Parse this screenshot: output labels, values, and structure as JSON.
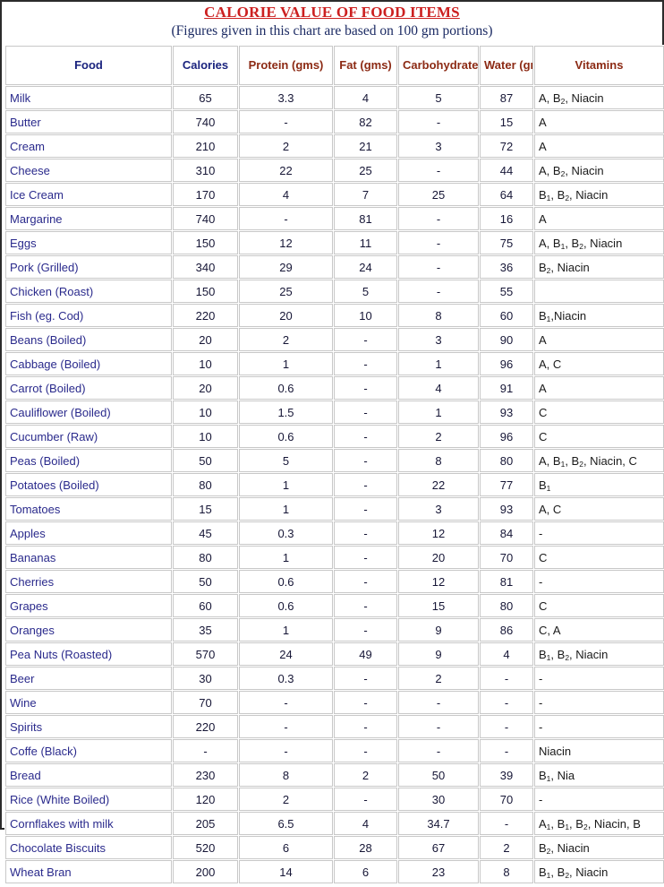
{
  "document": {
    "title": "CALORIE VALUE OF FOOD ITEMS",
    "subtitle": "(Figures given in this chart are based on 100 gm portions)",
    "title_color": "#cc2020",
    "subtitle_color": "#1b2a63"
  },
  "chart_data": {
    "type": "table",
    "title": "CALORIE VALUE OF FOOD ITEMS",
    "subtitle": "(Figures given in this chart are based on 100 gm portions)",
    "columns": [
      {
        "key": "food",
        "label": "Food",
        "color": "#1a237e",
        "align": "left"
      },
      {
        "key": "calories",
        "label": "Calories",
        "color": "#1a237e",
        "align": "center"
      },
      {
        "key": "protein",
        "label": "Protein (gms)",
        "color": "#8c2a14",
        "align": "center"
      },
      {
        "key": "fat",
        "label": "Fat (gms)",
        "color": "#8c2a14",
        "align": "center"
      },
      {
        "key": "carbohydrate",
        "label": "Carbohydrate (gms)",
        "color": "#8c2a14",
        "align": "center"
      },
      {
        "key": "water",
        "label": "Water (gms)",
        "color": "#8c2a14",
        "align": "center"
      },
      {
        "key": "vitamins",
        "label": "Vitamins",
        "color": "#8c2a14",
        "align": "left"
      }
    ],
    "rows": [
      {
        "food": "Milk",
        "calories": "65",
        "protein": "3.3",
        "fat": "4",
        "carbohydrate": "5",
        "water": "87",
        "vitamins": "A, B2, Niacin"
      },
      {
        "food": "Butter",
        "calories": "740",
        "protein": "-",
        "fat": "82",
        "carbohydrate": "-",
        "water": "15",
        "vitamins": "A"
      },
      {
        "food": "Cream",
        "calories": "210",
        "protein": "2",
        "fat": "21",
        "carbohydrate": "3",
        "water": "72",
        "vitamins": "A"
      },
      {
        "food": "Cheese",
        "calories": "310",
        "protein": "22",
        "fat": "25",
        "carbohydrate": "-",
        "water": "44",
        "vitamins": "A, B2, Niacin"
      },
      {
        "food": "Ice Cream",
        "calories": "170",
        "protein": "4",
        "fat": "7",
        "carbohydrate": "25",
        "water": "64",
        "vitamins": "B1, B2, Niacin"
      },
      {
        "food": "Margarine",
        "calories": "740",
        "protein": "-",
        "fat": "81",
        "carbohydrate": "-",
        "water": "16",
        "vitamins": "A"
      },
      {
        "food": "Eggs",
        "calories": "150",
        "protein": "12",
        "fat": "11",
        "carbohydrate": "-",
        "water": "75",
        "vitamins": "A, B1, B2, Niacin"
      },
      {
        "food": "Pork (Grilled)",
        "calories": "340",
        "protein": "29",
        "fat": "24",
        "carbohydrate": "-",
        "water": "36",
        "vitamins": "B2, Niacin"
      },
      {
        "food": "Chicken (Roast)",
        "calories": "150",
        "protein": "25",
        "fat": "5",
        "carbohydrate": "-",
        "water": "55",
        "vitamins": ""
      },
      {
        "food": "Fish (eg. Cod)",
        "calories": "220",
        "protein": "20",
        "fat": "10",
        "carbohydrate": "8",
        "water": "60",
        "vitamins": "B1,Niacin"
      },
      {
        "food": "Beans (Boiled)",
        "calories": "20",
        "protein": "2",
        "fat": "-",
        "carbohydrate": "3",
        "water": "90",
        "vitamins": "A"
      },
      {
        "food": "Cabbage (Boiled)",
        "calories": "10",
        "protein": "1",
        "fat": "-",
        "carbohydrate": "1",
        "water": "96",
        "vitamins": "A, C"
      },
      {
        "food": "Carrot (Boiled)",
        "calories": "20",
        "protein": "0.6",
        "fat": "-",
        "carbohydrate": "4",
        "water": "91",
        "vitamins": "A"
      },
      {
        "food": "Cauliflower (Boiled)",
        "calories": "10",
        "protein": "1.5",
        "fat": "-",
        "carbohydrate": "1",
        "water": "93",
        "vitamins": "C"
      },
      {
        "food": "Cucumber (Raw)",
        "calories": "10",
        "protein": "0.6",
        "fat": "-",
        "carbohydrate": "2",
        "water": "96",
        "vitamins": "C"
      },
      {
        "food": "Peas (Boiled)",
        "calories": "50",
        "protein": "5",
        "fat": "-",
        "carbohydrate": "8",
        "water": "80",
        "vitamins": "A, B1, B2, Niacin, C"
      },
      {
        "food": "Potatoes (Boiled)",
        "calories": "80",
        "protein": "1",
        "fat": "-",
        "carbohydrate": "22",
        "water": "77",
        "vitamins": "B1"
      },
      {
        "food": "Tomatoes",
        "calories": "15",
        "protein": "1",
        "fat": "-",
        "carbohydrate": "3",
        "water": "93",
        "vitamins": "A, C"
      },
      {
        "food": "Apples",
        "calories": "45",
        "protein": "0.3",
        "fat": "-",
        "carbohydrate": "12",
        "water": "84",
        "vitamins": "-"
      },
      {
        "food": "Bananas",
        "calories": "80",
        "protein": "1",
        "fat": "-",
        "carbohydrate": "20",
        "water": "70",
        "vitamins": "C"
      },
      {
        "food": "Cherries",
        "calories": "50",
        "protein": "0.6",
        "fat": "-",
        "carbohydrate": "12",
        "water": "81",
        "vitamins": "-"
      },
      {
        "food": "Grapes",
        "calories": "60",
        "protein": "0.6",
        "fat": "-",
        "carbohydrate": "15",
        "water": "80",
        "vitamins": "C"
      },
      {
        "food": "Oranges",
        "calories": "35",
        "protein": "1",
        "fat": "-",
        "carbohydrate": "9",
        "water": "86",
        "vitamins": "C, A"
      },
      {
        "food": "Pea Nuts (Roasted)",
        "calories": "570",
        "protein": "24",
        "fat": "49",
        "carbohydrate": "9",
        "water": "4",
        "vitamins": "B1, B2, Niacin"
      },
      {
        "food": "Beer",
        "calories": "30",
        "protein": "0.3",
        "fat": "-",
        "carbohydrate": "2",
        "water": "-",
        "vitamins": "-"
      },
      {
        "food": "Wine",
        "calories": "70",
        "protein": "-",
        "fat": "-",
        "carbohydrate": "-",
        "water": "-",
        "vitamins": "-"
      },
      {
        "food": "Spirits",
        "calories": "220",
        "protein": "-",
        "fat": "-",
        "carbohydrate": "-",
        "water": "-",
        "vitamins": "-"
      },
      {
        "food": "Coffe (Black)",
        "calories": "-",
        "protein": "-",
        "fat": "-",
        "carbohydrate": "-",
        "water": "-",
        "vitamins": "Niacin"
      },
      {
        "food": "Bread",
        "calories": "230",
        "protein": "8",
        "fat": "2",
        "carbohydrate": "50",
        "water": "39",
        "vitamins": "B1, Nia"
      },
      {
        "food": "Rice (White Boiled)",
        "calories": "120",
        "protein": "2",
        "fat": "-",
        "carbohydrate": "30",
        "water": "70",
        "vitamins": "-"
      },
      {
        "food": "Cornflakes with milk",
        "calories": "205",
        "protein": "6.5",
        "fat": "4",
        "carbohydrate": "34.7",
        "water": "-",
        "vitamins": "A1, B1, B2, Niacin, B"
      },
      {
        "food": "Chocolate Biscuits",
        "calories": "520",
        "protein": "6",
        "fat": "28",
        "carbohydrate": "67",
        "water": "2",
        "vitamins": "B2, Niacin"
      },
      {
        "food": "Wheat Bran",
        "calories": "200",
        "protein": "14",
        "fat": "6",
        "carbohydrate": "23",
        "water": "8",
        "vitamins": "B1, B2, Niacin"
      }
    ]
  }
}
